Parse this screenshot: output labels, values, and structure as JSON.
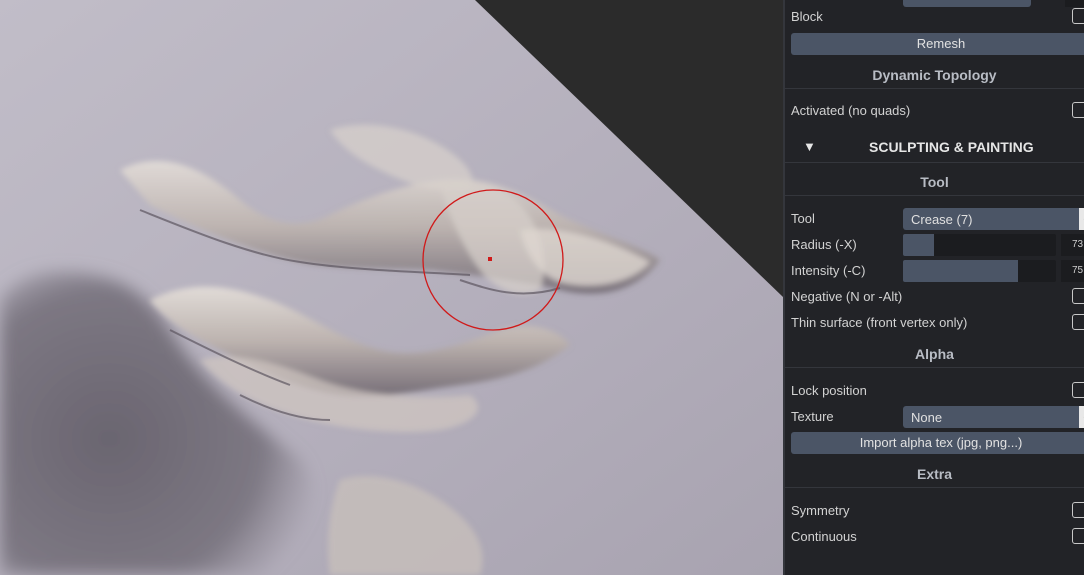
{
  "panel": {
    "block_label": "Block",
    "remesh_label": "Remesh",
    "dynamic_topology_title": "Dynamic Topology",
    "activated_label": "Activated (no quads)",
    "sculpting_header": "SCULPTING & PAINTING",
    "sculpting_arrow": "▼",
    "tool_section": "Tool",
    "tool_label": "Tool",
    "tool_value": "Crease (7)",
    "radius_label": "Radius (-X)",
    "radius_value": 73,
    "intensity_label": "Intensity (-C)",
    "intensity_value": 75,
    "negative_label": "Negative (N or -Alt)",
    "thin_surface_label": "Thin surface (front vertex only)",
    "alpha_section": "Alpha",
    "lock_position_label": "Lock position",
    "texture_label": "Texture",
    "texture_value": "None",
    "import_alpha_label": "Import alpha tex (jpg, png...)",
    "extra_section": "Extra",
    "symmetry_label": "Symmetry",
    "continuous_label": "Continuous",
    "chevron_glyph": "⌄",
    "checkbox_states": {
      "block": false,
      "activated": false,
      "negative": false,
      "thin_surface": false,
      "lock_position": false,
      "symmetry": false,
      "continuous": false
    }
  },
  "viewport": {
    "brush_cursor_color": "#d01a1a",
    "mesh_color": "#b6b1be",
    "background_color": "#2b2b2b"
  },
  "colors": {
    "panel_bg": "#222327",
    "widget_bg": "#4b5566",
    "text": "#d2d2d2"
  }
}
